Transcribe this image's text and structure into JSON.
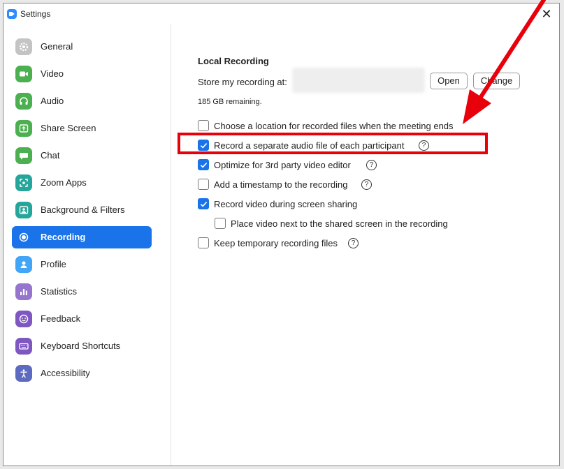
{
  "window": {
    "title": "Settings",
    "close_glyph": "✕"
  },
  "sidebar": {
    "items": [
      {
        "label": "General",
        "icon": "gear-icon",
        "color": "#bdbdbd"
      },
      {
        "label": "Video",
        "icon": "video-icon",
        "color": "#4caf50"
      },
      {
        "label": "Audio",
        "icon": "headphones-icon",
        "color": "#4caf50"
      },
      {
        "label": "Share Screen",
        "icon": "share-screen-icon",
        "color": "#4caf50"
      },
      {
        "label": "Chat",
        "icon": "chat-icon",
        "color": "#4caf50"
      },
      {
        "label": "Zoom Apps",
        "icon": "apps-icon",
        "color": "#26a69a"
      },
      {
        "label": "Background & Filters",
        "icon": "background-icon",
        "color": "#26a69a"
      },
      {
        "label": "Recording",
        "icon": "record-icon",
        "color": "#1a73e8"
      },
      {
        "label": "Profile",
        "icon": "profile-icon",
        "color": "#42a5f5"
      },
      {
        "label": "Statistics",
        "icon": "statistics-icon",
        "color": "#9575cd"
      },
      {
        "label": "Feedback",
        "icon": "feedback-icon",
        "color": "#7e57c2"
      },
      {
        "label": "Keyboard Shortcuts",
        "icon": "keyboard-icon",
        "color": "#7e57c2"
      },
      {
        "label": "Accessibility",
        "icon": "accessibility-icon",
        "color": "#5c6bc0"
      }
    ],
    "active": "Recording"
  },
  "recording": {
    "section_title": "Local Recording",
    "store_label": "Store my recording at:",
    "open_button": "Open",
    "change_button": "Change",
    "remaining": "185 GB remaining.",
    "options": [
      {
        "label": "Choose a location for recorded files when the meeting ends",
        "checked": false,
        "help": false
      },
      {
        "label": "Record a separate audio file of each participant",
        "checked": true,
        "help": true
      },
      {
        "label": "Optimize for 3rd party video editor",
        "checked": true,
        "help": true
      },
      {
        "label": "Add a timestamp to the recording",
        "checked": false,
        "help": true
      },
      {
        "label": "Record video during screen sharing",
        "checked": true,
        "help": false
      },
      {
        "label": "Place video next to the shared screen in the recording",
        "checked": false,
        "help": false
      },
      {
        "label": "Keep temporary recording files",
        "checked": false,
        "help": true
      }
    ],
    "help_glyph": "?"
  },
  "annotation": {
    "color": "#e8000b"
  }
}
